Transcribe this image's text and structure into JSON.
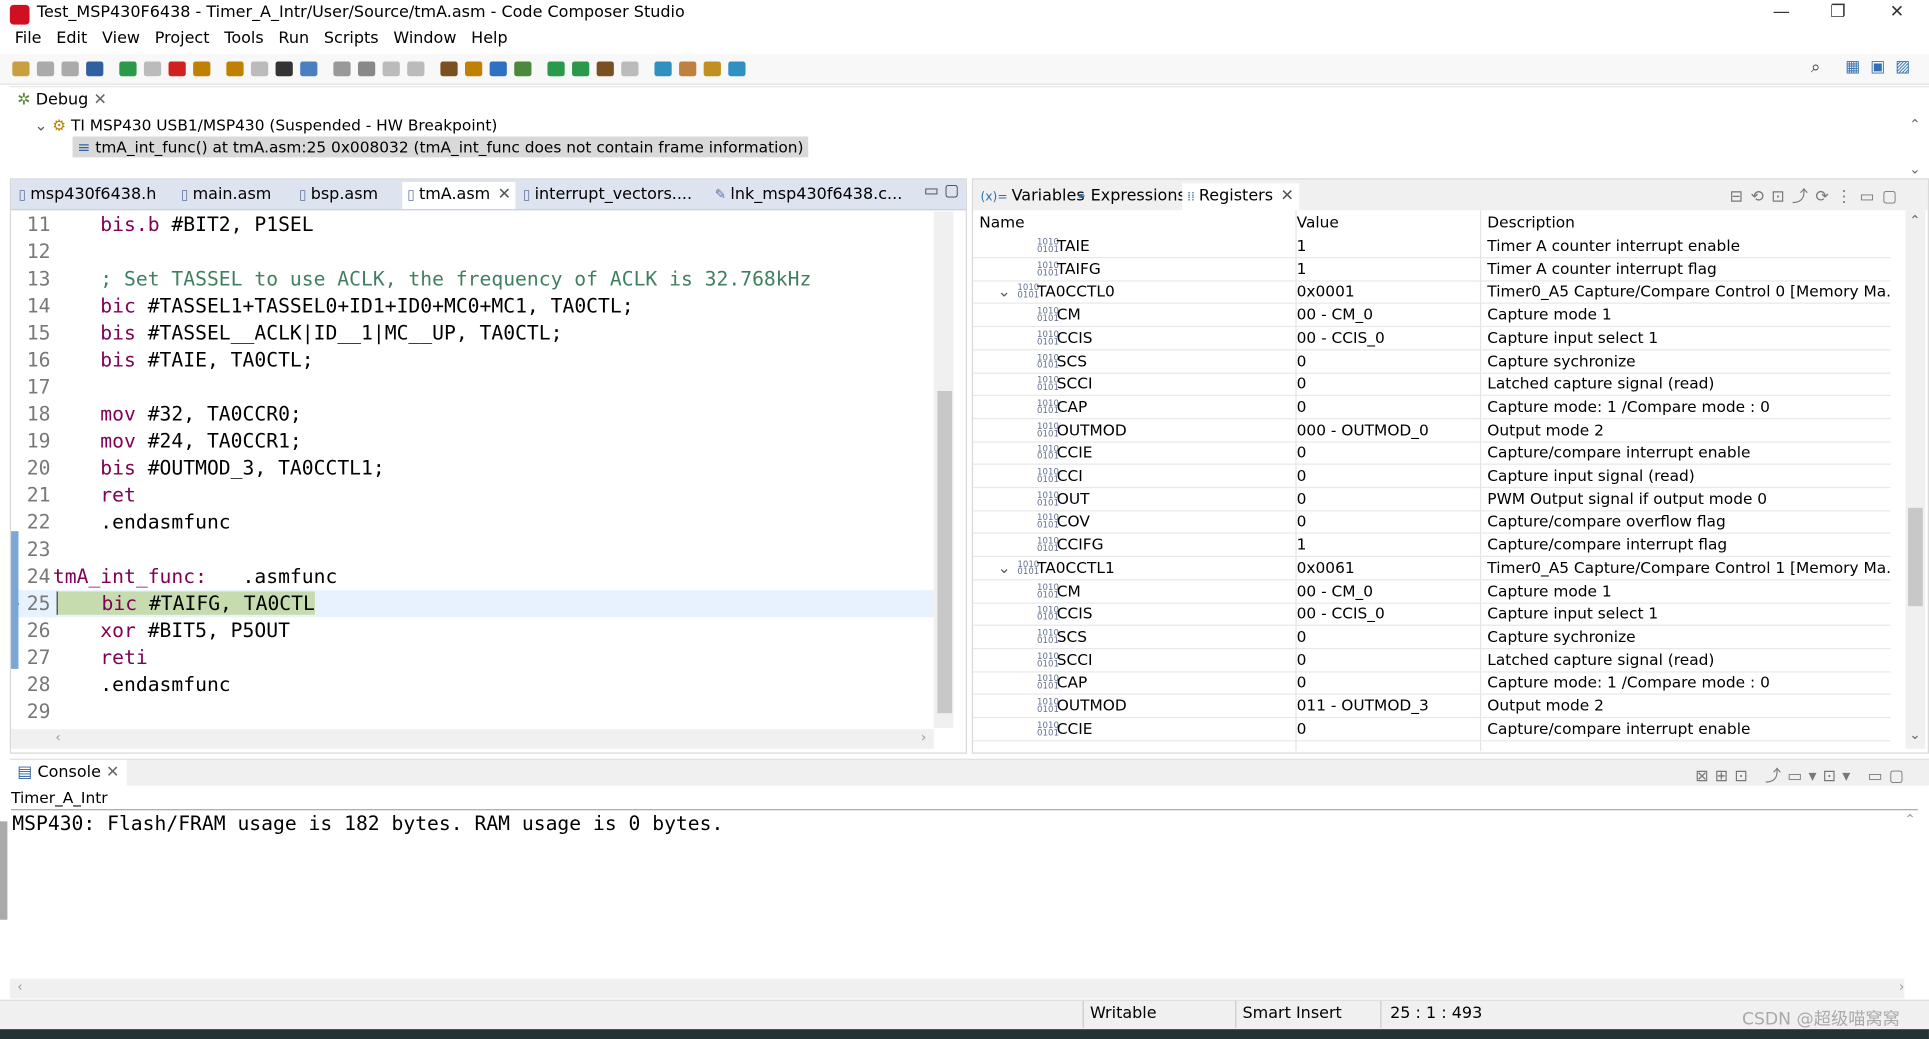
{
  "window": {
    "title": "Test_MSP430F6438 - Timer_A_Intr/User/Source/tmA.asm - Code Composer Studio",
    "minimize": "—",
    "restore": "❐",
    "close": "✕"
  },
  "menu": [
    "File",
    "Edit",
    "View",
    "Project",
    "Tools",
    "Run",
    "Scripts",
    "Window",
    "Help"
  ],
  "debug": {
    "tab": "Debug",
    "target": "TI MSP430 USB1/MSP430 (Suspended - HW Breakpoint)",
    "frame": "tmA_int_func() at tmA.asm:25 0x008032  (tmA_int_func does not contain frame information)"
  },
  "editor": {
    "tabs": [
      "msp430f6438.h",
      "main.asm",
      "bsp.asm",
      "tmA.asm",
      "interrupt_vectors....",
      "lnk_msp430f6438.c..."
    ],
    "active_tab": 3,
    "current_line": 25,
    "lines": [
      {
        "n": "11",
        "kw": "bis.b",
        "text": " #BIT2, P1SEL"
      },
      {
        "n": "12",
        "text": ""
      },
      {
        "n": "13",
        "comment": "; Set TASSEL to use ACLK, the frequency of ACLK is 32.768kHz"
      },
      {
        "n": "14",
        "kw": "bic",
        "text": " #TASSEL1+TASSEL0+ID1+ID0+MC0+MC1, TA0CTL;"
      },
      {
        "n": "15",
        "kw": "bis",
        "text": " #TASSEL__ACLK|ID__1|MC__UP, TA0CTL;"
      },
      {
        "n": "16",
        "kw": "bis",
        "text": " #TAIE, TA0CTL;"
      },
      {
        "n": "17",
        "text": ""
      },
      {
        "n": "18",
        "kw": "mov",
        "text": " #32, TA0CCR0;"
      },
      {
        "n": "19",
        "kw": "mov",
        "text": " #24, TA0CCR1;"
      },
      {
        "n": "20",
        "kw": "bis",
        "text": " #OUTMOD_3, TA0CCTL1;"
      },
      {
        "n": "21",
        "kw": "ret",
        "text": ""
      },
      {
        "n": "22",
        "text": ".endasmfunc"
      },
      {
        "n": "23",
        "text": ""
      },
      {
        "n": "24",
        "label": "tmA_int_func:",
        "text": "   .asmfunc"
      },
      {
        "n": "25",
        "kw": "bic",
        "text": " #TAIFG, TA0CTL"
      },
      {
        "n": "26",
        "kw": "xor",
        "text": " #BIT5, P5OUT"
      },
      {
        "n": "27",
        "kw": "reti",
        "text": ""
      },
      {
        "n": "28",
        "text": ".endasmfunc"
      },
      {
        "n": "29",
        "text": ""
      }
    ]
  },
  "registers": {
    "tabs": [
      "Variables",
      "Expressions",
      "Registers"
    ],
    "columns": [
      "Name",
      "Value",
      "Description"
    ],
    "rows": [
      {
        "name": "TAIE",
        "value": "1",
        "desc": "Timer A counter interrupt enable",
        "level": 2
      },
      {
        "name": "TAIFG",
        "value": "1",
        "desc": "Timer A counter interrupt flag",
        "level": 2
      },
      {
        "name": "TA0CCTL0",
        "value": "0x0001",
        "desc": "Timer0_A5 Capture/Compare Control 0 [Memory Ma...",
        "level": 1,
        "expanded": true
      },
      {
        "name": "CM",
        "value": "00 - CM_0",
        "desc": "Capture mode 1",
        "level": 2
      },
      {
        "name": "CCIS",
        "value": "00 - CCIS_0",
        "desc": "Capture input select 1",
        "level": 2
      },
      {
        "name": "SCS",
        "value": "0",
        "desc": "Capture sychronize",
        "level": 2
      },
      {
        "name": "SCCI",
        "value": "0",
        "desc": "Latched capture signal (read)",
        "level": 2
      },
      {
        "name": "CAP",
        "value": "0",
        "desc": "Capture mode: 1 /Compare mode : 0",
        "level": 2
      },
      {
        "name": "OUTMOD",
        "value": "000 - OUTMOD_0",
        "desc": "Output mode 2",
        "level": 2
      },
      {
        "name": "CCIE",
        "value": "0",
        "desc": "Capture/compare interrupt enable",
        "level": 2
      },
      {
        "name": "CCI",
        "value": "0",
        "desc": "Capture input signal (read)",
        "level": 2
      },
      {
        "name": "OUT",
        "value": "0",
        "desc": "PWM Output signal if output mode 0",
        "level": 2
      },
      {
        "name": "COV",
        "value": "0",
        "desc": "Capture/compare overflow flag",
        "level": 2
      },
      {
        "name": "CCIFG",
        "value": "1",
        "desc": "Capture/compare interrupt flag",
        "level": 2
      },
      {
        "name": "TA0CCTL1",
        "value": "0x0061",
        "desc": "Timer0_A5 Capture/Compare Control 1 [Memory Ma...",
        "level": 1,
        "expanded": true
      },
      {
        "name": "CM",
        "value": "00 - CM_0",
        "desc": "Capture mode 1",
        "level": 2
      },
      {
        "name": "CCIS",
        "value": "00 - CCIS_0",
        "desc": "Capture input select 1",
        "level": 2
      },
      {
        "name": "SCS",
        "value": "0",
        "desc": "Capture sychronize",
        "level": 2
      },
      {
        "name": "SCCI",
        "value": "0",
        "desc": "Latched capture signal (read)",
        "level": 2
      },
      {
        "name": "CAP",
        "value": "0",
        "desc": "Capture mode: 1 /Compare mode : 0",
        "level": 2
      },
      {
        "name": "OUTMOD",
        "value": "011 - OUTMOD_3",
        "desc": "Output mode 2",
        "level": 2
      },
      {
        "name": "CCIE",
        "value": "0",
        "desc": "Capture/compare interrupt enable",
        "level": 2
      }
    ]
  },
  "console": {
    "tab": "Console",
    "project": "Timer_A_Intr",
    "output": "MSP430:  Flash/FRAM usage is 182 bytes. RAM usage is 0 bytes."
  },
  "status": {
    "mode": "Writable",
    "insert": "Smart Insert",
    "position": "25 : 1 : 493"
  },
  "watermark": "CSDN @超级喵窝窝",
  "colors": {
    "keyword": "#7f0055",
    "comment": "#3f7f5f",
    "current_line": "#e8f2fe",
    "breakpoint_highlight": "#c7dcae"
  }
}
